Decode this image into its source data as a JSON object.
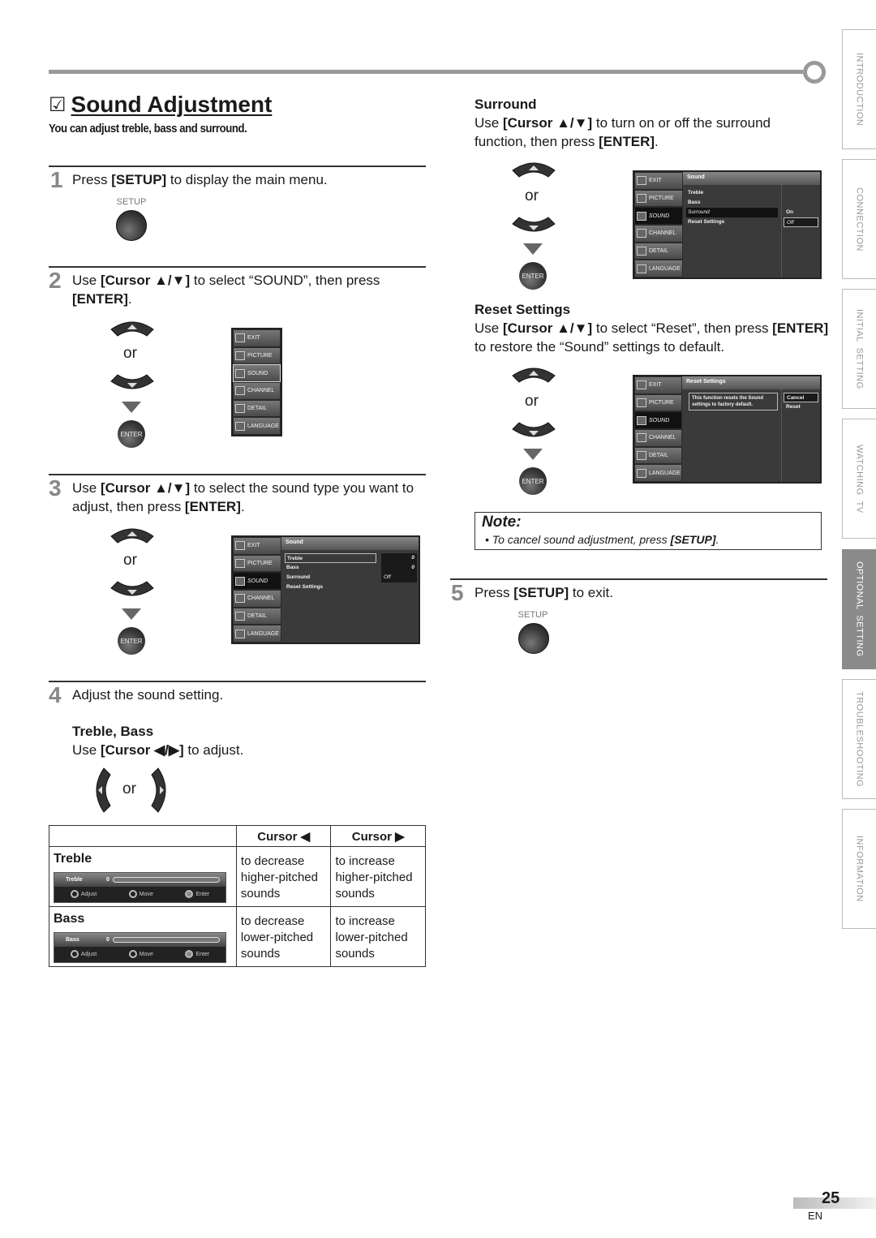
{
  "title": {
    "check_icon": "☑",
    "text": "Sound Adjustment",
    "subtitle": "You can adjust treble, bass and surround."
  },
  "side_tabs": [
    {
      "label": "INTRODUCTION",
      "active": false
    },
    {
      "label": "CONNECTION",
      "active": false
    },
    {
      "label": "INITIAL  SETTING",
      "active": false
    },
    {
      "label": "WATCHING  TV",
      "active": false
    },
    {
      "label": "OPTIONAL  SETTING",
      "active": true
    },
    {
      "label": "TROUBLESHOOTING",
      "active": false
    },
    {
      "label": "INFORMATION",
      "active": false
    }
  ],
  "remote": {
    "setup_label": "SETUP",
    "enter_label": "ENTER",
    "or": "or"
  },
  "steps": [
    {
      "num": "1",
      "pre": "Press ",
      "bold1": "[SETUP]",
      "post": " to display the main menu."
    },
    {
      "num": "2",
      "pre": "Use ",
      "bold1": "[Cursor ▲/▼]",
      "mid": " to select “SOUND”, then press ",
      "bold2": "[ENTER]",
      "post": "."
    },
    {
      "num": "3",
      "pre": "Use ",
      "bold1": "[Cursor ▲/▼]",
      "mid": " to select the sound type you want to adjust, then press ",
      "bold2": "[ENTER]",
      "post": "."
    },
    {
      "num": "4",
      "text": "Adjust the sound setting."
    },
    {
      "num": "5",
      "pre": "Press ",
      "bold1": "[SETUP]",
      "post": " to exit."
    }
  ],
  "tv_menu": {
    "side": [
      "EXIT",
      "PICTURE",
      "SOUND",
      "CHANNEL",
      "DETAIL",
      "LANGUAGE"
    ],
    "sound_header": "Sound",
    "sound_items": [
      "Treble",
      "Bass",
      "Surround",
      "Reset Settings"
    ],
    "sound_values": [
      "0",
      "0",
      "Off"
    ],
    "surround_options": [
      "On",
      "Off"
    ],
    "reset_header": "Reset Settings",
    "reset_message": "This function resets the Sound settings to factory default.",
    "reset_options": [
      "Cancel",
      "Reset"
    ]
  },
  "treble_bass": {
    "heading": "Treble, Bass",
    "pre": "Use ",
    "bold": "[Cursor ◀/▶]",
    "post": " to adjust.",
    "table": {
      "headers": [
        "",
        "Cursor ◀",
        "Cursor ▶"
      ],
      "rows": [
        {
          "label": "Treble",
          "slider_label": "Treble",
          "slider_value": "0",
          "decrease": "to decrease higher-pitched sounds",
          "increase": "to increase higher-pitched sounds"
        },
        {
          "label": "Bass",
          "slider_label": "Bass",
          "slider_value": "0",
          "decrease": "to decrease lower-pitched sounds",
          "increase": "to increase lower-pitched sounds"
        }
      ],
      "footer": [
        "Adjust",
        "Move",
        "Enter"
      ]
    }
  },
  "surround": {
    "heading": "Surround",
    "pre": "Use ",
    "bold1": "[Cursor ▲/▼]",
    "mid": " to turn on or off the surround function, then press ",
    "bold2": "[ENTER]",
    "post": "."
  },
  "reset": {
    "heading": "Reset Settings",
    "pre": "Use ",
    "bold1": "[Cursor ▲/▼]",
    "mid": " to select “Reset”, then press ",
    "bold2": "[ENTER]",
    "post": " to restore the “Sound” settings to default."
  },
  "note": {
    "title": "Note:",
    "pre": "To cancel sound adjustment, press ",
    "bold": "[SETUP]",
    "post": "."
  },
  "footer": {
    "page": "25",
    "lang": "EN"
  }
}
